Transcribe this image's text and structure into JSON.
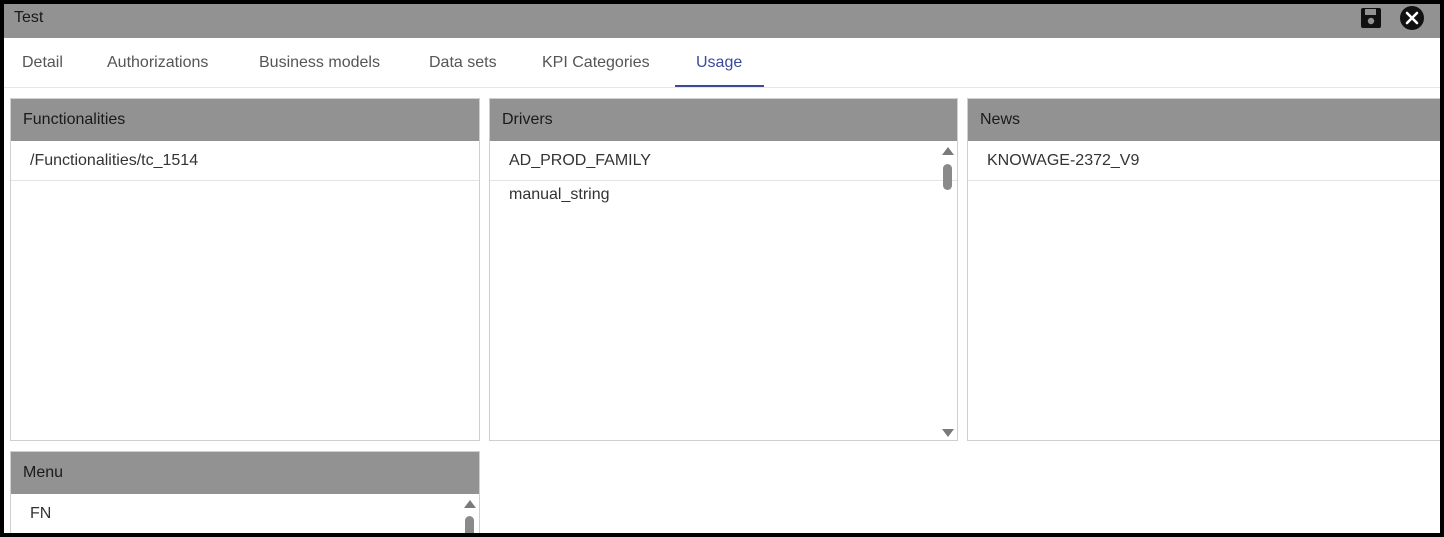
{
  "window": {
    "title": "Test",
    "save_icon": "save-icon",
    "close_icon": "close-icon"
  },
  "tabs": [
    {
      "label": "Detail"
    },
    {
      "label": "Authorizations"
    },
    {
      "label": "Business models"
    },
    {
      "label": "Data sets"
    },
    {
      "label": "KPI Categories"
    },
    {
      "label": "Usage",
      "active": true
    }
  ],
  "panels": {
    "functionalities": {
      "header": "Functionalities",
      "items": [
        "/Functionalities/tc_1514"
      ]
    },
    "drivers": {
      "header": "Drivers",
      "items": [
        "AD_PROD_FAMILY",
        "manual_string"
      ]
    },
    "news": {
      "header": "News",
      "items": [
        "KNOWAGE-2372_V9"
      ]
    },
    "menu": {
      "header": "Menu",
      "items": [
        "FN"
      ]
    }
  },
  "colors": {
    "header_bg": "#929292",
    "accent": "#3b4a9b",
    "frame_border": "#000000"
  }
}
